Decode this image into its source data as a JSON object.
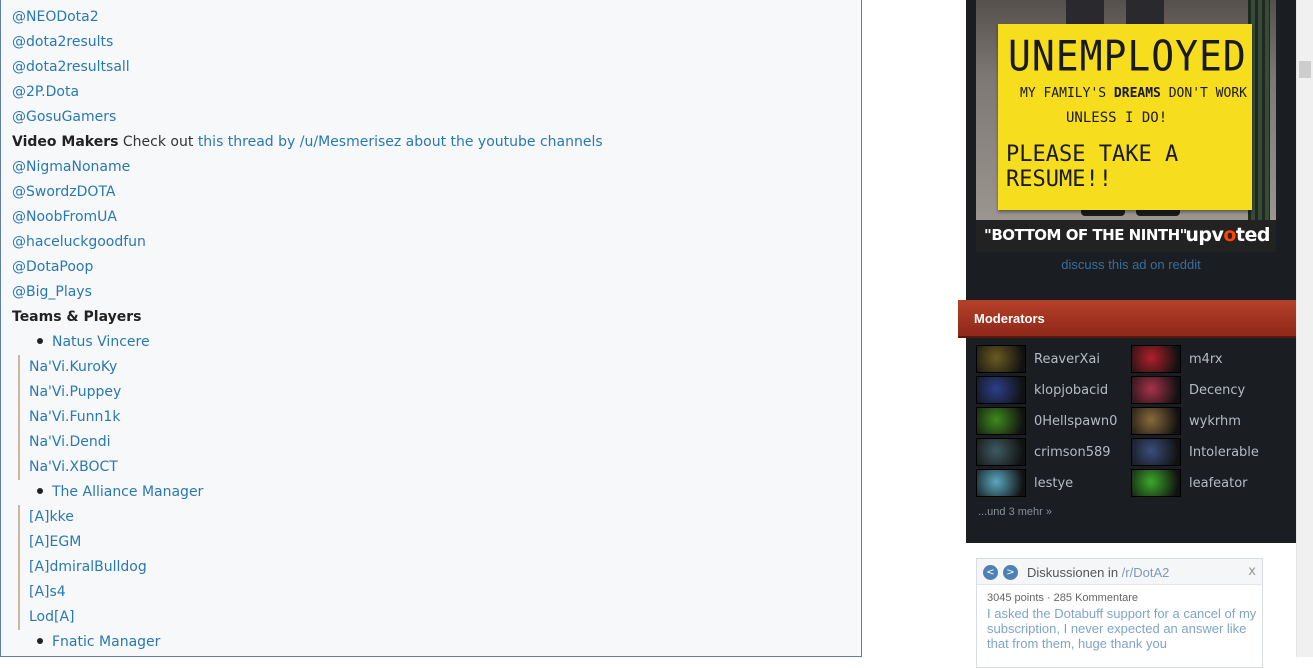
{
  "content": {
    "lines": [
      {
        "type": "link",
        "text": "@NEODota2"
      },
      {
        "type": "link",
        "text": "@dota2results"
      },
      {
        "type": "link",
        "text": "@dota2resultsall"
      },
      {
        "type": "link",
        "text": "@2P.Dota"
      },
      {
        "type": "link",
        "text": "@GosuGamers"
      },
      {
        "type": "mixed",
        "bold": "Video Makers",
        "plain": " Check out ",
        "link": "this thread by /u/Mesmerisez about the youtube channels"
      },
      {
        "type": "link",
        "text": "@NigmaNoname"
      },
      {
        "type": "link",
        "text": "@SwordzDOTA"
      },
      {
        "type": "link",
        "text": "@NoobFromUA"
      },
      {
        "type": "link",
        "text": "@haceluckgoodfun"
      },
      {
        "type": "link",
        "text": "@DotaPoop"
      },
      {
        "type": "link",
        "text": "@Big_Plays"
      },
      {
        "type": "heading",
        "text": "Teams & Players"
      },
      {
        "type": "bullet",
        "text": "Natus Vincere"
      },
      {
        "type": "quote",
        "text": "Na'Vi.KuroKy"
      },
      {
        "type": "quote",
        "text": "Na'Vi.Puppey"
      },
      {
        "type": "quote",
        "text": "Na'Vi.Funn1k"
      },
      {
        "type": "quote",
        "text": "Na'Vi.Dendi"
      },
      {
        "type": "quote",
        "text": "Na'Vi.XBOCT"
      },
      {
        "type": "bullet",
        "text": "The Alliance Manager"
      },
      {
        "type": "quote",
        "text": "[A]kke"
      },
      {
        "type": "quote",
        "text": "[A]EGM"
      },
      {
        "type": "quote",
        "text": "[A]dmiralBulldog"
      },
      {
        "type": "quote",
        "text": "[A]s4"
      },
      {
        "type": "quote",
        "text": "Lod[A]"
      },
      {
        "type": "bullet",
        "text": "Fnatic Manager"
      }
    ]
  },
  "ad": {
    "sign_line1": "UNEMPLOYED",
    "sign_line2_a": "MY FAMILY'S ",
    "sign_line2_b": "DREAMS",
    "sign_line2_c": " DON'T WORK",
    "sign_line3": "UNLESS I DO!",
    "sign_line4": "PLEASE TAKE A RESUME!!",
    "caption": "\"BOTTOM OF THE NINTH\"",
    "brand_a": "upv",
    "brand_b": "o",
    "brand_c": "ted",
    "discuss_link": "discuss this ad on reddit"
  },
  "moderators": {
    "title": "Moderators",
    "list": [
      {
        "name": "ReaverXai",
        "color": "#6b5a20"
      },
      {
        "name": "m4rx",
        "color": "#b0202a"
      },
      {
        "name": "klopjobacid",
        "color": "#2c3f8a"
      },
      {
        "name": "Decency",
        "color": "#a8324a"
      },
      {
        "name": "0Hellspawn0",
        "color": "#3e8a1e"
      },
      {
        "name": "wykrhm",
        "color": "#8a6a3a"
      },
      {
        "name": "crimson589",
        "color": "#3f5a62"
      },
      {
        "name": "Intolerable",
        "color": "#3a4e7a"
      },
      {
        "name": "lestye",
        "color": "#5aa8c0"
      },
      {
        "name": "leafeator",
        "color": "#3aa82a"
      }
    ],
    "more": "...und 3 mehr »"
  },
  "discussions": {
    "prev": "<",
    "next": ">",
    "title_prefix": "Diskussionen in ",
    "title_sub": "/r/DotA2",
    "close": "x",
    "meta": "3045 points · 285 Kommentare",
    "text": "I asked the Dotabuff support for a cancel of my subscription, I never expected an answer like that from them, huge thank you"
  }
}
